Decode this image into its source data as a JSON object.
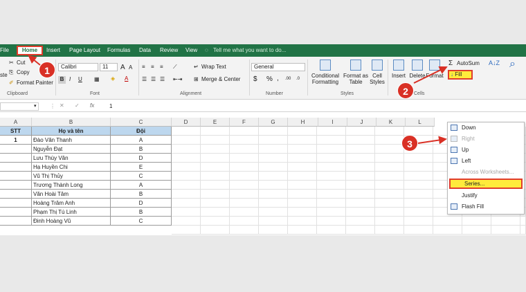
{
  "menu": {
    "file": "File",
    "home": "Home",
    "insert": "Insert",
    "page_layout": "Page Layout",
    "formulas": "Formulas",
    "data": "Data",
    "review": "Review",
    "view": "View",
    "tell_me": "Tell me what you want to do..."
  },
  "ribbon": {
    "clipboard": {
      "paste": "ste",
      "cut": "Cut",
      "copy": "Copy",
      "format_painter": "Format Painter",
      "label": "Clipboard"
    },
    "font": {
      "name": "Calibri",
      "size": "11",
      "grow": "A",
      "shrink": "A",
      "bold": "B",
      "italic": "I",
      "underline": "U",
      "label": "Font"
    },
    "alignment": {
      "wrap": "Wrap Text",
      "merge": "Merge & Center",
      "label": "Alignment"
    },
    "number": {
      "format": "General",
      "currency": "$",
      "percent": "%",
      "comma": ",",
      "inc": ".00",
      "dec": ".0",
      "label": "Number"
    },
    "styles": {
      "conditional": "Conditional",
      "conditional2": "Formatting",
      "format_as": "Format as",
      "format_as2": "Table",
      "cell": "Cell",
      "cell2": "Styles",
      "label": "Styles"
    },
    "cells": {
      "insert": "Insert",
      "delete": "Delete",
      "format": "Format",
      "label": "Cells"
    },
    "editing": {
      "autosum": "AutoSum",
      "fill": "Fill"
    }
  },
  "formula_bar": {
    "name_box": "",
    "fx": "fx",
    "value": "1"
  },
  "columns": [
    "A",
    "B",
    "C",
    "D",
    "E",
    "F",
    "G",
    "H",
    "I",
    "J",
    "K",
    "L"
  ],
  "table": {
    "headers": [
      "STT",
      "Họ và tên",
      "Đội"
    ],
    "rows": [
      [
        "1",
        "Đào Văn Thanh",
        "A"
      ],
      [
        "",
        "Nguyễn Đạt",
        "B"
      ],
      [
        "",
        "Lưu Thùy Vân",
        "D"
      ],
      [
        "",
        "Hạ Huyền Chi",
        "E"
      ],
      [
        "",
        "Vũ Thị Thủy",
        "C"
      ],
      [
        "",
        "Trương Thành Long",
        "A"
      ],
      [
        "",
        "Văn Hoài Tâm",
        "B"
      ],
      [
        "",
        "Hoàng Trâm Anh",
        "D"
      ],
      [
        "",
        "Phạm Thị Tú Linh",
        "B"
      ],
      [
        "",
        "Đinh Hoàng Vũ",
        "C"
      ]
    ]
  },
  "fill_menu": {
    "down": "Down",
    "right": "Right",
    "up": "Up",
    "left": "Left",
    "across": "Across Worksheets...",
    "series": "Series...",
    "justify": "Justify",
    "flash": "Flash Fill"
  },
  "steps": [
    "1",
    "2",
    "3"
  ],
  "colors": {
    "excel_green": "#217346",
    "highlight_yellow": "#ffeb3b",
    "callout_red": "#d93025",
    "header_blue": "#bdd7ee"
  }
}
